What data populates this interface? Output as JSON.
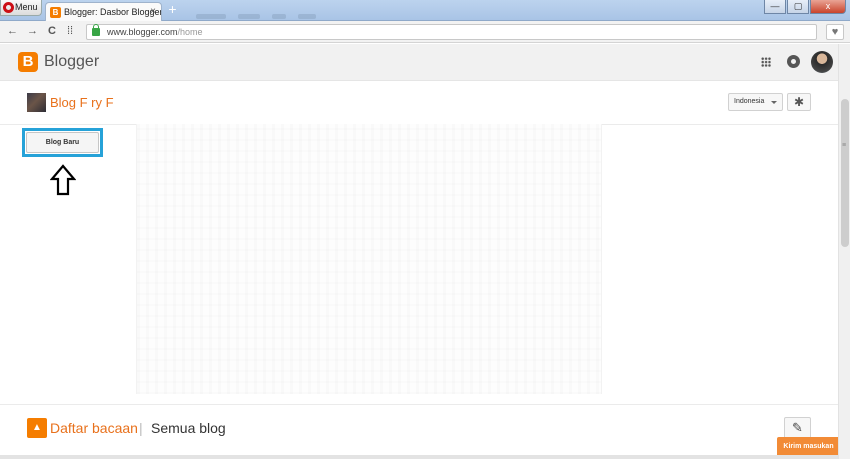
{
  "browser": {
    "menu_label": "Menu",
    "tab_title": "Blogger: Dasbor Blogger",
    "tab_close": "×",
    "new_tab": "+",
    "url_host": "www.blogger.com",
    "url_path": "/home",
    "back": "←",
    "forward": "→",
    "reload": "C",
    "speed_dial": "⁞⁞",
    "heart": "♥",
    "win_min": "—",
    "win_max": "▢",
    "win_close": "x"
  },
  "header": {
    "logo_letter": "B",
    "brand": "Blogger"
  },
  "blog": {
    "title": "Blog F  ry F",
    "language": "Indonesia",
    "settings_glyph": "✱"
  },
  "main": {
    "new_blog_label": "Blog Baru"
  },
  "reading_list": {
    "icon_glyph": "▲",
    "label": "Daftar bacaan",
    "separator": "|",
    "all_blogs": "Semua blog",
    "edit_glyph": "✎"
  },
  "feedback": {
    "label": "Kirim masukan"
  },
  "colors": {
    "brand_orange": "#f57d00",
    "highlight_blue": "#26a2d8"
  }
}
